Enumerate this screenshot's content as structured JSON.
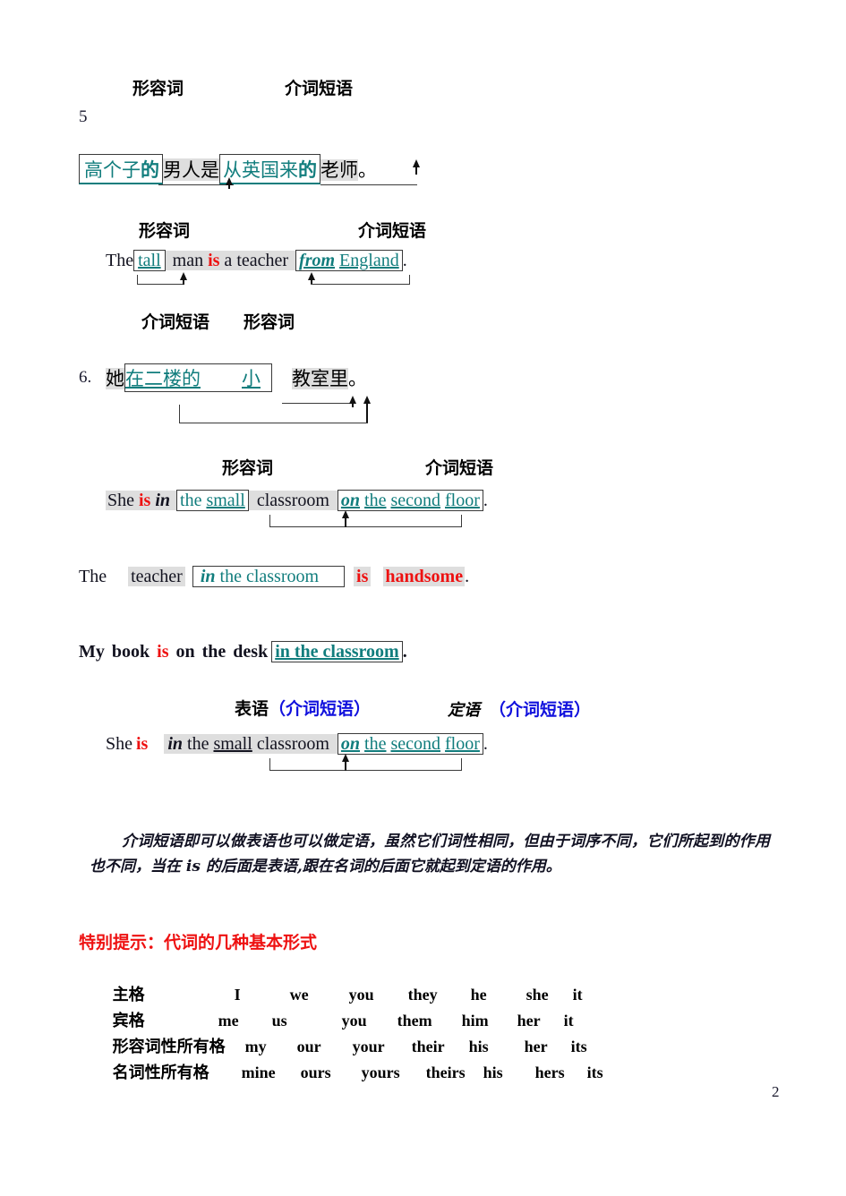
{
  "document": {
    "page_number": "2",
    "list_marker_5": "5",
    "list_marker_6": "6."
  },
  "section_5": {
    "labels_top": {
      "adjective": "形容词",
      "prep_phrase": "介词短语"
    },
    "chinese_sentence": {
      "part1_boxed": "高个子",
      "part1_de": "的",
      "part2": "男人是",
      "part3_boxed": "从英国来",
      "part3_de": "的",
      "part4": "老师",
      "period": "。"
    },
    "labels_mid": {
      "adjective": "形容词",
      "prep_phrase": "介词短语"
    },
    "english_sentence": {
      "w1": "The",
      "w2_boxed": "tall",
      "w3": "man",
      "w4_is": "is",
      "w5": "a",
      "w6": "teacher",
      "w7_from": "from",
      "w8": "England",
      "period": "."
    }
  },
  "section_6": {
    "labels_top": {
      "prep_phrase": "介词短语",
      "adjective": "形容词"
    },
    "chinese_sentence": {
      "subject": "她",
      "boxed_prep": "在二楼的",
      "boxed_adj": "小",
      "noun": "教室里",
      "period": "。"
    },
    "labels_mid": {
      "adjective": "形容词",
      "prep_phrase": "介词短语"
    },
    "english_sentence": {
      "w1": "She",
      "w2_is": "is",
      "w3_in": "in",
      "w4": "the",
      "w5": "small",
      "w6": "classroom",
      "w7_on": "on",
      "w8": "the",
      "w9": "second",
      "w10": "floor",
      "period": "."
    }
  },
  "example_teacher": {
    "w1": "The",
    "w2": "teacher",
    "w3_in": "in",
    "w4": "the",
    "w5": "classroom",
    "w6_is": "is",
    "w7_handsome": "handsome",
    "period": "."
  },
  "example_mybook": {
    "w1": "My",
    "w2": "book",
    "w3_is": "is",
    "w4": "on",
    "w5": "the",
    "w6": "desk",
    "w7_boxed": "in  the  classroom",
    "period": "."
  },
  "section_roles": {
    "label_predicative": "表语",
    "label_predicative_paren": "（介词短语）",
    "label_attributive": "定语",
    "label_attributive_paren": "（介词短语）",
    "english_sentence": {
      "w1": "She",
      "w2_is": "is",
      "w3_in": "in",
      "w4": "the",
      "w5": "small",
      "w6": "classroom",
      "w7_on": "on",
      "w8": "the",
      "w9": "second",
      "w10": "floor",
      "period": "."
    }
  },
  "explanation": {
    "text": "介词短语即可以做表语也可以做定语，虽然它们词性相同，但由于词序不同，它们所起到的作用也不同，当在 is 的后面是表语,跟在名词的后面它就起到定语的作用。"
  },
  "tip": {
    "title": "特别提示：代词的几种基本形式",
    "rows": [
      {
        "label": "主格",
        "words": [
          "I",
          "we",
          "you",
          "they",
          "he",
          "she",
          "it"
        ]
      },
      {
        "label": "宾格",
        "words": [
          "me",
          "us",
          "you",
          "them",
          "him",
          "her",
          "it"
        ]
      },
      {
        "label": "形容词性所有格",
        "words": [
          "my",
          "our",
          "your",
          "their",
          "his",
          "her",
          "its"
        ]
      },
      {
        "label": "名词性所有格",
        "words": [
          "mine",
          "ours",
          "yours",
          "theirs",
          "his",
          "hers",
          "its"
        ]
      }
    ]
  },
  "colors": {
    "teal": "#117d7d",
    "red": "#ee1111",
    "blue": "#1111dd",
    "highlight": "#dedede",
    "box_border": "#3a3a3a"
  }
}
